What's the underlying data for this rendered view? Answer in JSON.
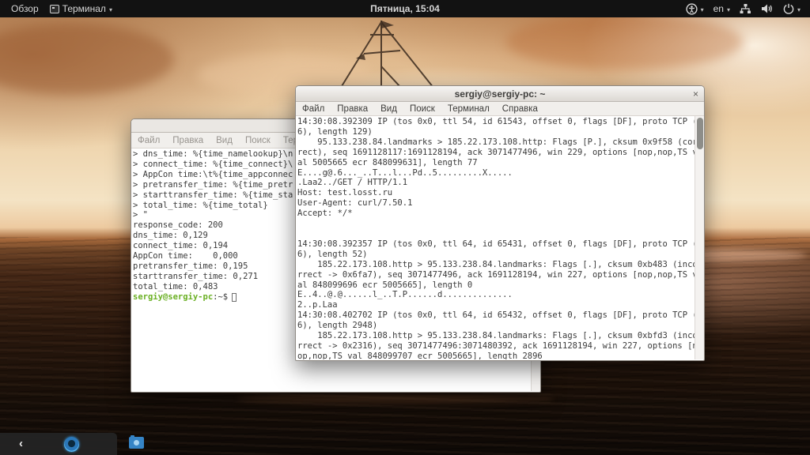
{
  "top_bar": {
    "activities_label": "Обзор",
    "app_menu_label": "Терминал",
    "clock": "Пятница, 15:04",
    "language": "en",
    "icons": [
      "terminal-icon",
      "accessibility-icon",
      "network-wired-icon",
      "volume-icon",
      "power-icon"
    ]
  },
  "front_window": {
    "title": "sergiy@sergiy-pc: ~",
    "close_glyph": "×",
    "menu": [
      "Файл",
      "Правка",
      "Вид",
      "Поиск",
      "Терминал",
      "Справка"
    ],
    "lines": [
      "14:30:08.392309 IP (tos 0x0, ttl 54, id 61543, offset 0, flags [DF], proto TCP (",
      "6), length 129)",
      "    95.133.238.84.landmarks > 185.22.173.108.http: Flags [P.], cksum 0x9f58 (cor",
      "rect), seq 1691128117:1691128194, ack 3071477496, win 229, options [nop,nop,TS v",
      "al 5005665 ecr 848099631], length 77",
      "E....g@.6..._..T...l...Pd..5.........X.....",
      ".Laa2../GET / HTTP/1.1",
      "Host: test.losst.ru",
      "User-Agent: curl/7.50.1",
      "Accept: */*",
      "",
      "",
      "14:30:08.392357 IP (tos 0x0, ttl 64, id 65431, offset 0, flags [DF], proto TCP (",
      "6), length 52)",
      "    185.22.173.108.http > 95.133.238.84.landmarks: Flags [.], cksum 0xb483 (inco",
      "rrect -> 0x6fa7), seq 3071477496, ack 1691128194, win 227, options [nop,nop,TS v",
      "al 848099696 ecr 5005665], length 0",
      "E..4..@.@......l_..T.P......d..............",
      "2..p.Laa",
      "14:30:08.402702 IP (tos 0x0, ttl 64, id 65432, offset 0, flags [DF], proto TCP (",
      "6), length 2948)",
      "    185.22.173.108.http > 95.133.238.84.landmarks: Flags [.], cksum 0xbfd3 (inco",
      "rrect -> 0x2316), seq 3071477496:3071480392, ack 1691128194, win 227, options [n",
      "op,nop,TS val 848099707 ecr 5005665], length 2896"
    ]
  },
  "back_window": {
    "menu": [
      "Файл",
      "Правка",
      "Вид",
      "Поиск",
      "Терминал"
    ],
    "lines": [
      "> dns_time: %{time_namelookup}\\n",
      "> connect_time: %{time_connect}\\",
      "> AppCon time:\\t%{time_appconnec",
      "> pretransfer_time: %{time_pretr",
      "> starttransfer_time: %{time_sta",
      "> total_time: %{time_total}",
      "> \"",
      "response_code: 200",
      "dns_time: 0,129",
      "connect_time: 0,194",
      "AppCon time:    0,000",
      "pretransfer_time: 0,195",
      "starttransfer_time: 0,271",
      "total_time: 0,483"
    ],
    "prompt": {
      "user": "sergiy@sergiy-pc",
      "suffix": ":~$"
    }
  },
  "colors": {
    "prompt_green": "#6ab023",
    "topbar_bg": "#121212",
    "terminal_bg": "#ffffff",
    "terminal_text": "#3a3a3a",
    "accent_blue": "#3584c6"
  }
}
